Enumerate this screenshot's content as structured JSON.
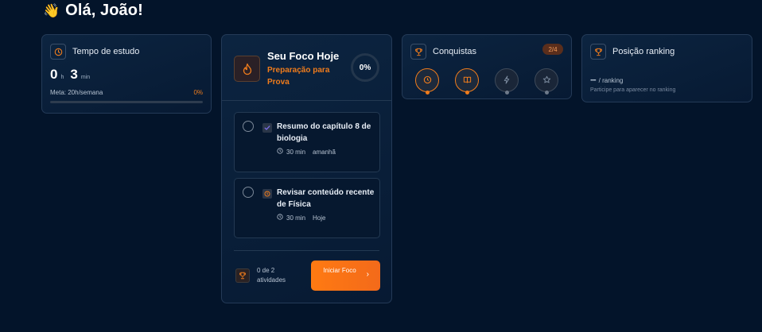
{
  "greeting": {
    "emoji": "👋",
    "text": "Olá, João!"
  },
  "study_time": {
    "title": "Tempo de estudo",
    "icon": "clock-icon",
    "hours": "0",
    "hours_unit": "h",
    "minutes": "3",
    "minutes_unit": "min",
    "goal_label": "Meta: 20h/semana",
    "progress_label": "0%",
    "progress": 0
  },
  "focus": {
    "title": "Seu Foco Hoje",
    "subtitle": "Preparação para Prova",
    "icon": "flame-icon",
    "percent": "0%",
    "tasks": [
      {
        "title": "Resumo do capítulo 8 de biologia",
        "tag_icon": "check-icon",
        "duration": "30 min",
        "when": "amanhã"
      },
      {
        "title": "Revisar conteúdo recente de Física",
        "tag_icon": "clock-icon",
        "duration": "30 min",
        "when": "Hoje"
      }
    ],
    "count_label": "0 de 2 atividades",
    "start_label": "Iniciar Foco",
    "accent": "#f07c1c"
  },
  "achievements": {
    "title": "Conquistas",
    "icon": "trophy-icon",
    "badge": "2/4",
    "items": [
      {
        "icon": "clock-icon",
        "unlocked": true
      },
      {
        "icon": "book-icon",
        "unlocked": true
      },
      {
        "icon": "bolt-icon",
        "unlocked": false
      },
      {
        "icon": "star-icon",
        "unlocked": false
      }
    ]
  },
  "ranking": {
    "title": "Posição ranking",
    "icon": "trophy-icon",
    "position": "--",
    "suffix": "/ ranking",
    "hint": "Participe para aparecer no ranking"
  }
}
